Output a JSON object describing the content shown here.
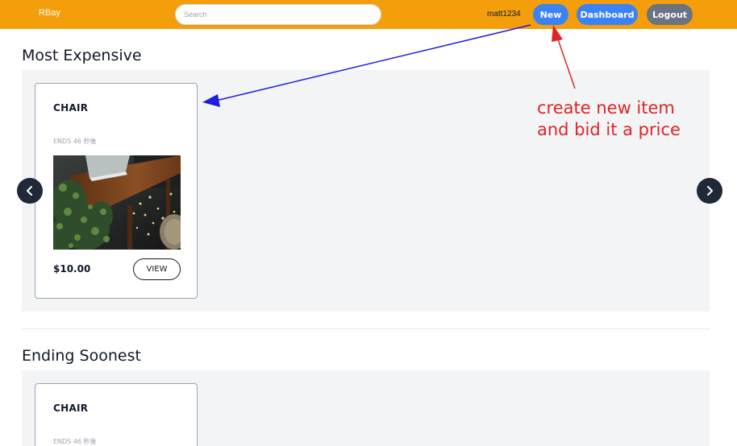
{
  "navbar": {
    "brand": "RBay",
    "search_placeholder": "Search",
    "username": "matt1234",
    "new_label": "New",
    "dashboard_label": "Dashboard",
    "logout_label": "Logout",
    "bg_color": "#f59e0b",
    "primary_button_color": "#3b82f6",
    "secondary_button_color": "#6b7280"
  },
  "sections": [
    {
      "title": "Most Expensive",
      "items": [
        {
          "title": "CHAIR",
          "ends": "ENDS 46 秒後",
          "price": "$10.00",
          "view_label": "VIEW",
          "image": "desk-with-plants-photo"
        }
      ]
    },
    {
      "title": "Ending Soonest",
      "items": [
        {
          "title": "CHAIR",
          "ends": "ENDS 46 秒後"
        }
      ]
    }
  ],
  "annotation": {
    "line1": "create new item",
    "line2": "and bid it a price",
    "color": "#dc2626",
    "arrow_colors": [
      "#dc2626",
      "#1d1de0"
    ]
  },
  "icons": {
    "prev": "chevron-left-icon",
    "next": "chevron-right-icon"
  }
}
